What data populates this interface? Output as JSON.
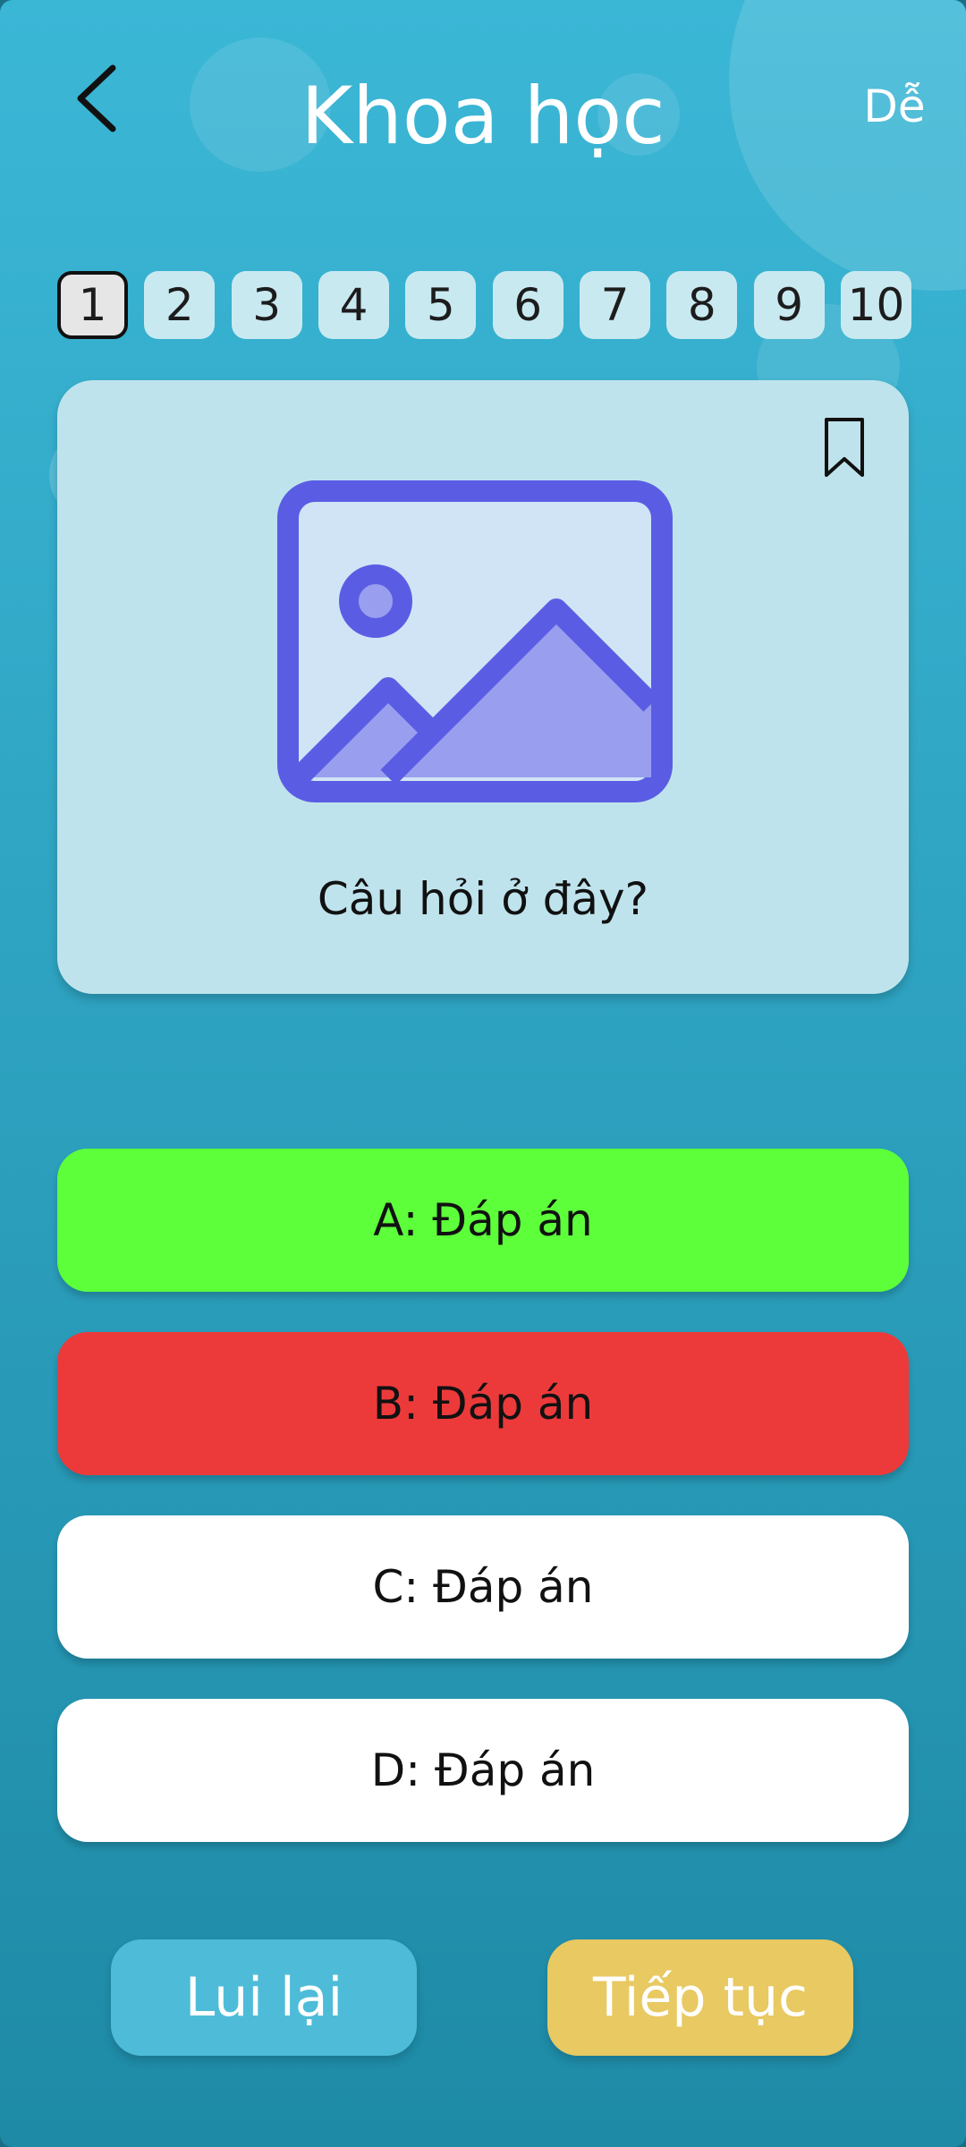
{
  "header": {
    "title": "Khoa học",
    "difficulty": "Dễ",
    "back_icon": "chevron-left-icon"
  },
  "question_nav": {
    "items": [
      "1",
      "2",
      "3",
      "4",
      "5",
      "6",
      "7",
      "8",
      "9",
      "10"
    ],
    "active": "1"
  },
  "question": {
    "text": "Câu hỏi ở đây?",
    "image_icon": "image-placeholder-icon",
    "bookmark_icon": "bookmark-icon"
  },
  "answers": [
    {
      "label": "A: Đáp án",
      "state": "correct",
      "color": "#5dfe3a"
    },
    {
      "label": "B: Đáp án",
      "state": "wrong",
      "color": "#ec3a3b"
    },
    {
      "label": "C: Đáp án",
      "state": "neutral",
      "color": "#ffffff"
    },
    {
      "label": "D: Đáp án",
      "state": "neutral",
      "color": "#ffffff"
    }
  ],
  "footer": {
    "prev_label": "Lui lại",
    "next_label": "Tiếp tục"
  },
  "colors": {
    "background_top": "#3bb7d6",
    "background_bottom": "#1e8aa6",
    "card": "#bfe3ec",
    "icon_accent": "#5a5de3",
    "prev_button": "#4ebcd8",
    "next_button": "#e8c962"
  }
}
